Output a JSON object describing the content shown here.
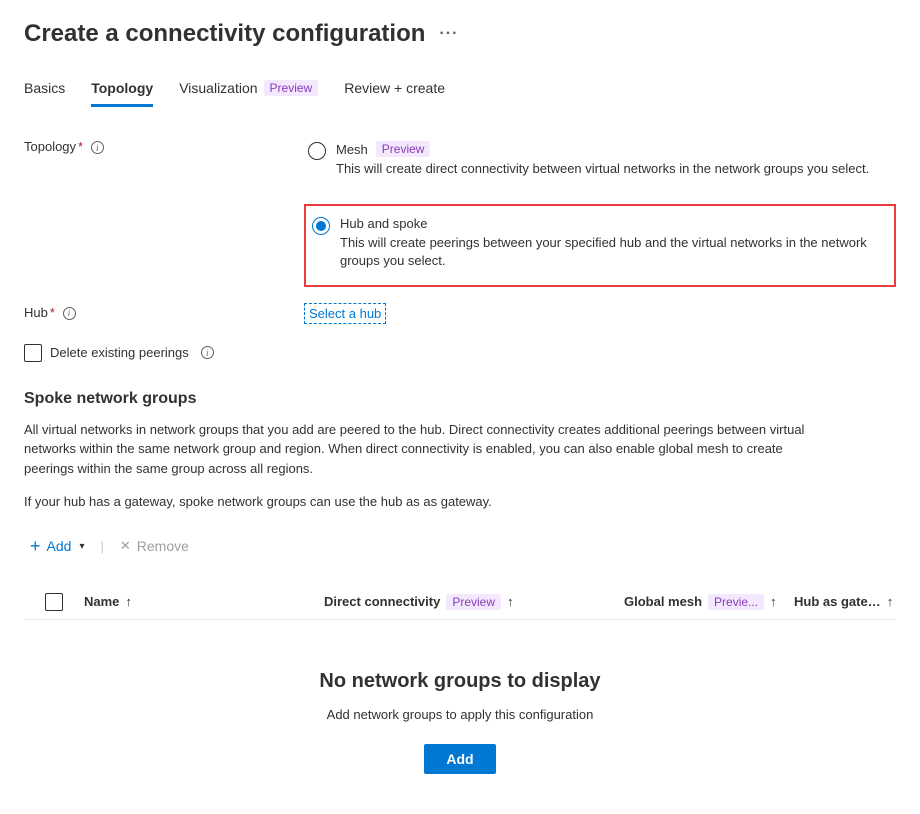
{
  "page_title": "Create a connectivity configuration",
  "tabs": {
    "basics": "Basics",
    "topology": "Topology",
    "visualization": "Visualization",
    "visualization_badge": "Preview",
    "review": "Review + create"
  },
  "topology": {
    "label": "Topology",
    "mesh": {
      "title": "Mesh",
      "badge": "Preview",
      "desc": "This will create direct connectivity between virtual networks in the network groups you select."
    },
    "hub_spoke": {
      "title": "Hub and spoke",
      "desc": "This will create peerings between your specified hub and the virtual networks in the network groups you select."
    }
  },
  "hub": {
    "label": "Hub",
    "select_link": "Select a hub"
  },
  "delete_peerings": {
    "label": "Delete existing peerings"
  },
  "spoke": {
    "heading": "Spoke network groups",
    "para1": "All virtual networks in network groups that you add are peered to the hub. Direct connectivity creates additional peerings between virtual networks within the same network group and region. When direct connectivity is enabled, you can also enable global mesh to create peerings within the same group across all regions.",
    "para2": "If your hub has a gateway, spoke network groups can use the hub as as gateway."
  },
  "toolbar": {
    "add": "Add",
    "remove": "Remove"
  },
  "table": {
    "name": "Name",
    "direct": "Direct connectivity",
    "direct_badge": "Preview",
    "global": "Global mesh",
    "global_badge": "Previe...",
    "hub_gw": "Hub as gate…"
  },
  "empty": {
    "title": "No network groups to display",
    "sub": "Add network groups to apply this configuration",
    "button": "Add"
  }
}
